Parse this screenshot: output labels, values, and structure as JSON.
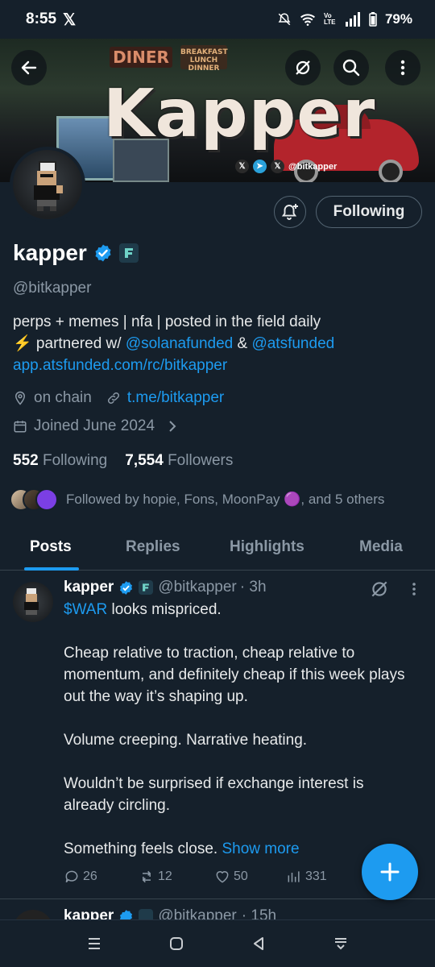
{
  "status_bar": {
    "time": "8:55",
    "battery": "79%",
    "network": "Vo LTE"
  },
  "banner": {
    "signs": [
      "DINER",
      "BREAKFAST LUNCH DINNER"
    ],
    "big_text": "Kapper",
    "social_handle": "@bitkapper"
  },
  "profile": {
    "display_name": "kapper",
    "handle": "@bitkapper",
    "follow_button": "Following",
    "bio": {
      "line1": "perps + memes  | nfa | posted in the field daily",
      "line2_prefix": "⚡ partnered w/ ",
      "mention1": "@solanafunded",
      "amp": " & ",
      "mention2": "@atsfunded",
      "link": "app.atsfunded.com/rc/bitkapper"
    },
    "location": "on chain",
    "website": "t.me/bitkapper",
    "joined": "Joined June 2024",
    "following_count": "552",
    "following_label": "Following",
    "followers_count": "7,554",
    "followers_label": "Followers",
    "followed_by": "Followed by hopie, Fons, MoonPay 🟣, and 5 others"
  },
  "tabs": [
    "Posts",
    "Replies",
    "Highlights",
    "Media"
  ],
  "tweet": {
    "name": "kapper",
    "handle": "@bitkapper",
    "time": "· 3h",
    "cashtag": "$WAR",
    "line1_rest": " looks mispriced.",
    "para2": "Cheap relative to traction, cheap relative to momentum, and definitely cheap if this week plays out the way it’s shaping up.",
    "para3": "Volume creeping. Narrative heating.",
    "para4": "Wouldn’t be surprised if exchange interest is already circling.",
    "para5": "Something feels close. ",
    "show_more": "Show more",
    "replies": "26",
    "reposts": "12",
    "likes": "50",
    "views": "331"
  },
  "tweet2": {
    "name": "kapper",
    "handle": "@bitkapper",
    "time": "· 15h"
  },
  "colors": {
    "accent": "#1d9bf0",
    "background": "#15202b",
    "secondary_text": "#8b98a5"
  }
}
